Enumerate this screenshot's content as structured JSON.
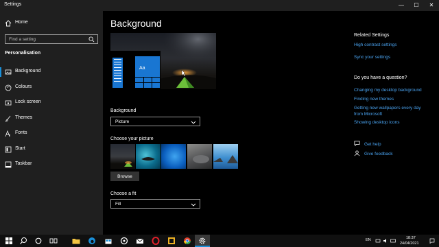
{
  "window": {
    "title": "Settings",
    "min": "—",
    "max": "☐",
    "close": "✕"
  },
  "sidebar": {
    "home": "Home",
    "search_placeholder": "Find a setting",
    "section": "Personalisation",
    "items": [
      {
        "label": "Background",
        "icon": "image-icon",
        "active": true
      },
      {
        "label": "Colours",
        "icon": "palette-icon"
      },
      {
        "label": "Lock screen",
        "icon": "lock-screen-icon"
      },
      {
        "label": "Themes",
        "icon": "brush-icon"
      },
      {
        "label": "Fonts",
        "icon": "font-icon"
      },
      {
        "label": "Start",
        "icon": "start-icon"
      },
      {
        "label": "Taskbar",
        "icon": "taskbar-icon"
      }
    ]
  },
  "main": {
    "title": "Background",
    "preview_tile_text": "Aa",
    "background_label": "Background",
    "background_value": "Picture",
    "choose_picture_label": "Choose your picture",
    "browse": "Browse",
    "fit_label": "Choose a fit",
    "fit_value": "Fill"
  },
  "related": {
    "heading": "Related Settings",
    "links": [
      "High contrast settings",
      "Sync your settings"
    ]
  },
  "question": {
    "heading": "Do you have a question?",
    "links": [
      "Changing my desktop background",
      "Finding new themes",
      "Getting new wallpapers every day from Microsoft",
      "Showing desktop icons"
    ]
  },
  "help": {
    "get_help": "Get help",
    "give_feedback": "Give feedback"
  },
  "taskbar": {
    "apps": [
      "windows-start-icon",
      "search-icon",
      "cortana-icon",
      "task-view-icon",
      "file-explorer-icon",
      "edge-icon",
      "store-icon",
      "app-icon",
      "mail-icon",
      "opera-icon",
      "photos-icon",
      "chrome-icon",
      "settings-icon"
    ],
    "lang": "EN",
    "time": "18:37",
    "date": "24/04/2021"
  },
  "colors": {
    "accent": "#1a8fd8",
    "link": "#4aa3f0"
  }
}
